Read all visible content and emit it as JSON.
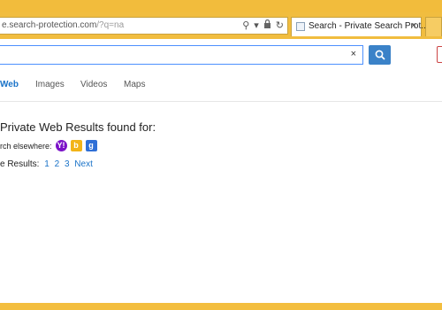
{
  "browser": {
    "address_url_visible": "e.search-protection.com",
    "address_url_rest": "/?q=na",
    "tab_title": "Search - Private Search Prot...",
    "tab_close": "×",
    "address_icons": {
      "search": "⚲",
      "dropdown": "▾",
      "lock": "🔒",
      "refresh": "↻"
    }
  },
  "search": {
    "query": "",
    "clear_label": "×"
  },
  "nav": {
    "tabs": [
      {
        "label": "Web",
        "active": true
      },
      {
        "label": "Images",
        "active": false
      },
      {
        "label": "Videos",
        "active": false
      },
      {
        "label": "Maps",
        "active": false
      }
    ]
  },
  "results": {
    "heading": "Private Web Results found for:",
    "elsewhere_label": "rch elsewhere:",
    "engines": [
      {
        "name": "yahoo",
        "glyph": "Y!"
      },
      {
        "name": "bing",
        "glyph": "b"
      },
      {
        "name": "google",
        "glyph": "g"
      }
    ],
    "pager_label": "e Results:",
    "pages": [
      "1",
      "2",
      "3"
    ],
    "next_label": "Next"
  },
  "colors": {
    "chrome": "#f1bd3f",
    "accent": "#1a73c8",
    "search_button": "#3b82c8"
  }
}
